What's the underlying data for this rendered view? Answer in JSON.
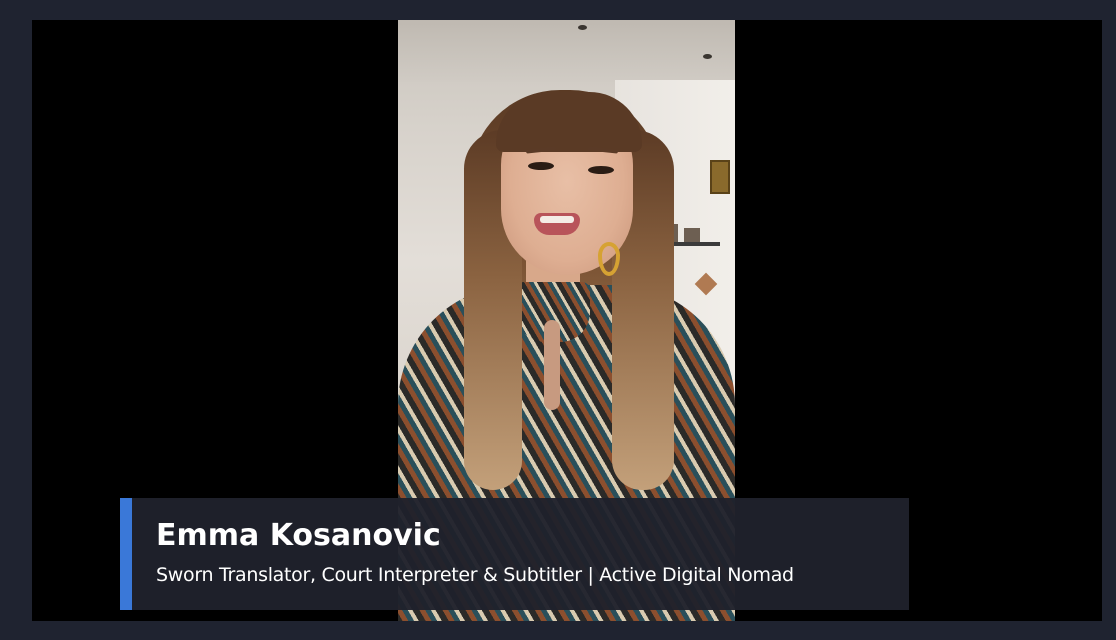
{
  "lower_third": {
    "name": "Emma Kosanovic",
    "title": "Sworn Translator, Court Interpreter & Subtitler | Active Digital Nomad",
    "accent_color": "#3a78d8",
    "background_color": "#1f212c"
  },
  "video": {
    "background_color": "#000000"
  },
  "frame": {
    "background_color": "#1f2330"
  }
}
